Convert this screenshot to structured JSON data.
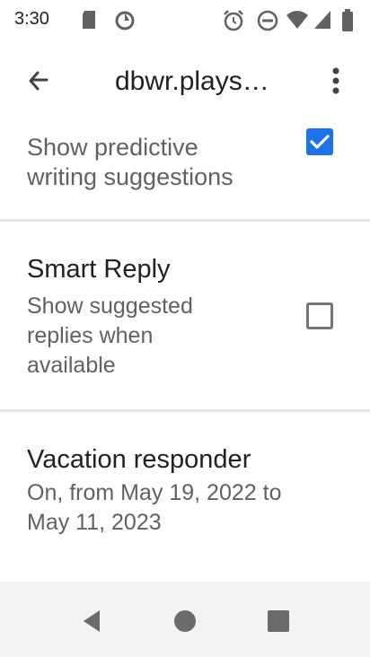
{
  "status_bar": {
    "time": "3:30",
    "left_icons": [
      "sd-card-icon",
      "sync-icon"
    ],
    "right_icons": [
      "alarm-icon",
      "do-not-disturb-icon",
      "wifi-icon",
      "cellular-icon",
      "battery-icon"
    ]
  },
  "app_bar": {
    "title": "dbwr.plays…",
    "back_icon": "arrow-back-icon",
    "more_icon": "more-vert-icon"
  },
  "settings": {
    "predictive": {
      "summary_line1": "Show predictive",
      "summary_line2": "writing suggestions",
      "checked": true
    },
    "smart_reply": {
      "title": "Smart Reply",
      "summary_line1": "Show suggested",
      "summary_line2": "replies when",
      "summary_line3": "available",
      "checked": false
    },
    "vacation": {
      "title": "Vacation responder",
      "summary_line1": "On, from May 19, 2022 to",
      "summary_line2": "May 11, 2023"
    }
  },
  "colors": {
    "accent": "#1a73e8",
    "divider": "#e4e4e4",
    "nav_bar": "#f2f2f2"
  },
  "nav_bar": {
    "buttons": [
      "back-triangle-icon",
      "home-circle-icon",
      "recents-square-icon"
    ]
  }
}
